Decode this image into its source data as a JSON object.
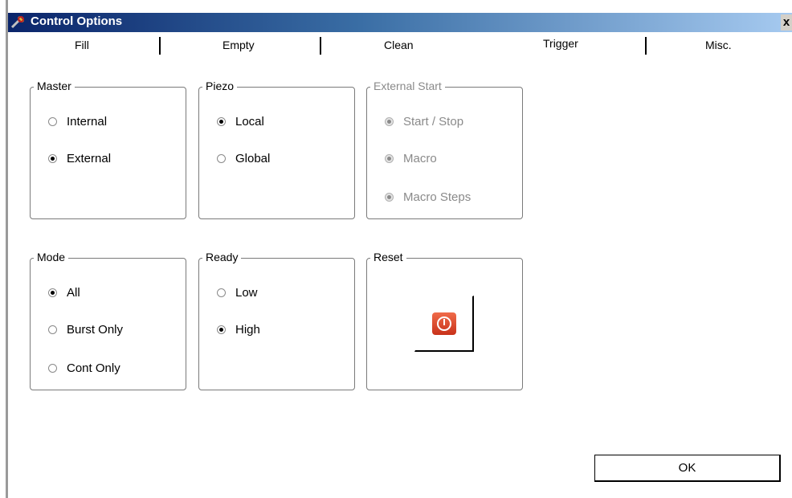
{
  "window": {
    "title": "Control Options",
    "close_label": "x",
    "icon": "tools-icon"
  },
  "tabs": [
    {
      "label": "Fill"
    },
    {
      "label": "Empty"
    },
    {
      "label": "Clean"
    },
    {
      "label": "Trigger"
    },
    {
      "label": "Misc."
    }
  ],
  "groups": {
    "master": {
      "legend": "Master",
      "options": [
        {
          "label": "Internal",
          "checked": false
        },
        {
          "label": "External",
          "checked": true
        }
      ]
    },
    "piezo": {
      "legend": "Piezo",
      "options": [
        {
          "label": "Local",
          "checked": true
        },
        {
          "label": "Global",
          "checked": false
        }
      ]
    },
    "external_start": {
      "legend": "External Start",
      "disabled": true,
      "options": [
        {
          "label": "Start / Stop",
          "checked": true
        },
        {
          "label": "Macro",
          "checked": true
        },
        {
          "label": "Macro Steps",
          "checked": true
        }
      ]
    },
    "mode": {
      "legend": "Mode",
      "options": [
        {
          "label": "All",
          "checked": true
        },
        {
          "label": "Burst Only",
          "checked": false
        },
        {
          "label": "Cont Only",
          "checked": false
        }
      ]
    },
    "ready": {
      "legend": "Ready",
      "options": [
        {
          "label": "Low",
          "checked": false
        },
        {
          "label": "High",
          "checked": true
        }
      ]
    },
    "reset": {
      "legend": "Reset",
      "icon": "power-icon",
      "icon_color": "#d9411f"
    }
  },
  "ok_label": "OK"
}
